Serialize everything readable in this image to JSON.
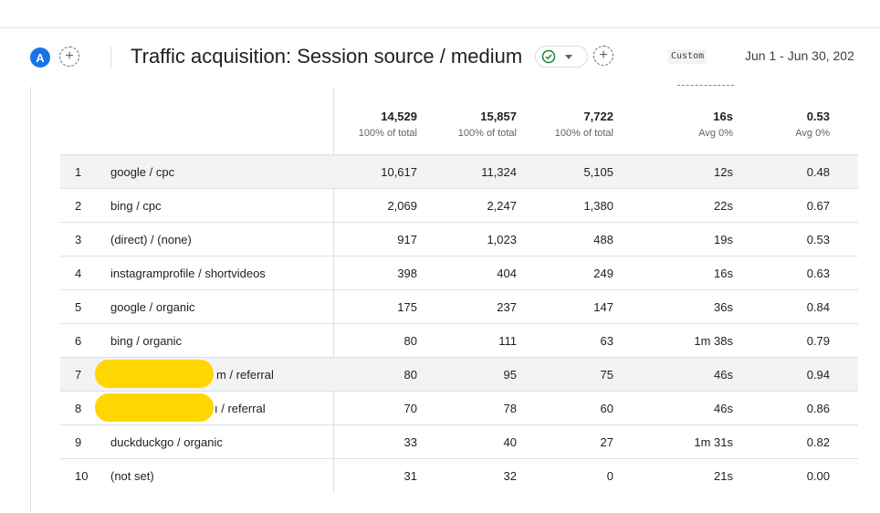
{
  "header": {
    "avatar_letter": "A",
    "add_compare_label": "+",
    "title": "Traffic acquisition: Session source / medium",
    "add_label": "+",
    "date_chip": "Custom",
    "date_range": "Jun 1 - Jun 30, 202"
  },
  "totals": [
    {
      "value": "14,529",
      "sub": "100% of total"
    },
    {
      "value": "15,857",
      "sub": "100% of total"
    },
    {
      "value": "7,722",
      "sub": "100% of total"
    },
    {
      "value": "16s",
      "sub": "Avg 0%"
    },
    {
      "value": "0.53",
      "sub": "Avg 0%"
    }
  ],
  "rows": [
    {
      "rank": "1",
      "source": "google / cpc",
      "v1": "10,617",
      "v2": "11,324",
      "v3": "5,105",
      "v4": "12s",
      "v5": "0.48"
    },
    {
      "rank": "2",
      "source": "bing / cpc",
      "v1": "2,069",
      "v2": "2,247",
      "v3": "1,380",
      "v4": "22s",
      "v5": "0.67"
    },
    {
      "rank": "3",
      "source": "(direct) / (none)",
      "v1": "917",
      "v2": "1,023",
      "v3": "488",
      "v4": "19s",
      "v5": "0.53"
    },
    {
      "rank": "4",
      "source": "instagramprofile / shortvideos",
      "v1": "398",
      "v2": "404",
      "v3": "249",
      "v4": "16s",
      "v5": "0.63"
    },
    {
      "rank": "5",
      "source": "google / organic",
      "v1": "175",
      "v2": "237",
      "v3": "147",
      "v4": "36s",
      "v5": "0.84"
    },
    {
      "rank": "6",
      "source": "bing / organic",
      "v1": "80",
      "v2": "111",
      "v3": "63",
      "v4": "1m 38s",
      "v5": "0.79"
    },
    {
      "rank": "7",
      "source": "m / referral",
      "v1": "80",
      "v2": "95",
      "v3": "75",
      "v4": "46s",
      "v5": "0.94"
    },
    {
      "rank": "8",
      "source": "ı / referral",
      "v1": "70",
      "v2": "78",
      "v3": "60",
      "v4": "46s",
      "v5": "0.86"
    },
    {
      "rank": "9",
      "source": "duckduckgo / organic",
      "v1": "33",
      "v2": "40",
      "v3": "27",
      "v4": "1m 31s",
      "v5": "0.82"
    },
    {
      "rank": "10",
      "source": "(not set)",
      "v1": "31",
      "v2": "32",
      "v3": "0",
      "v4": "21s",
      "v5": "0.00"
    }
  ],
  "colors": {
    "accent": "#1a73e8",
    "check": "#188038",
    "redaction": "#ffd600"
  }
}
